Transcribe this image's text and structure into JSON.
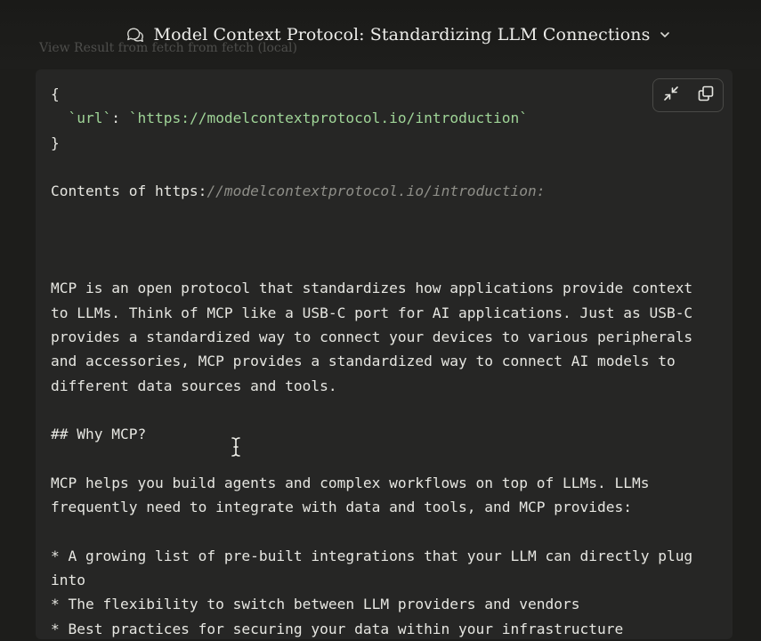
{
  "header": {
    "title": "Model Context Protocol: Standardizing LLM Connections",
    "ghost_label": "View Result from fetch from fetch (local)"
  },
  "toolbar": {
    "collapse_icon": "collapse-arrows-icon",
    "copy_icon": "copy-icon"
  },
  "code": {
    "brace_open": "{",
    "key": "`url`",
    "colon": ": ",
    "value": "`https://modelcontextprotocol.io/introduction`",
    "brace_close": "}",
    "contents_prefix": "Contents of https:",
    "contents_url": "//modelcontextprotocol.io/introduction:",
    "para1": [
      "MCP is an open protocol that standardizes how applications provide context",
      "to LLMs. Think of MCP like a USB-C port for AI applications. Just as USB-C",
      "provides a standardized way to connect your devices to various peripherals",
      "and accessories, MCP provides a standardized way to connect AI models to",
      "different data sources and tools."
    ],
    "heading": "## Why MCP?",
    "para2": [
      "MCP helps you build agents and complex workflows on top of LLMs. LLMs",
      "frequently need to integrate with data and tools, and MCP provides:"
    ],
    "bullets": [
      "* A growing list of pre-built integrations that your LLM can directly plug",
      "into",
      "* The flexibility to switch between LLM providers and vendors",
      "* Best practices for securing your data within your infrastructure"
    ]
  },
  "colors": {
    "background": "#1d1d1b",
    "panel": "#262625",
    "string": "#9fd497",
    "text": "#e6e6e1"
  }
}
